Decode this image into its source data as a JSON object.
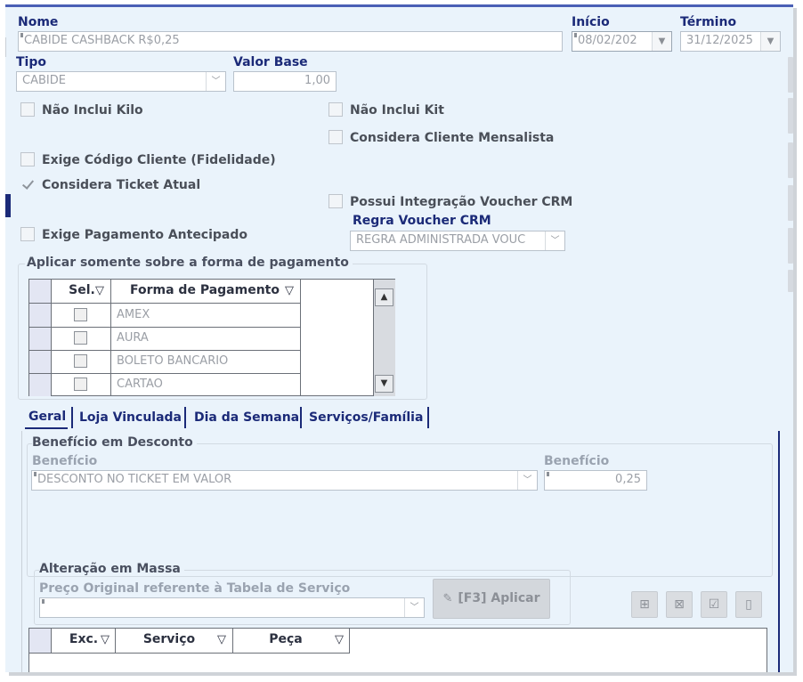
{
  "form": {
    "nome_label": "Nome",
    "nome_value": "CABIDE CASHBACK R$0,25",
    "inicio_label": "Início",
    "inicio_value": "08/02/202",
    "termino_label": "Término",
    "termino_value": "31/12/2025",
    "tipo_label": "Tipo",
    "tipo_value": "CABIDE",
    "valor_base_label": "Valor Base",
    "valor_base_value": "1,00",
    "regra_voucher_label": "Regra Voucher CRM",
    "regra_voucher_value": "REGRA ADMINISTRADA VOUC"
  },
  "checkboxes": {
    "nao_inclui_kilo": {
      "label": "Não Inclui Kilo",
      "checked": false
    },
    "nao_inclui_kit": {
      "label": "Não Inclui Kit",
      "checked": false
    },
    "considera_cliente_mensalista": {
      "label": "Considera Cliente Mensalista",
      "checked": false
    },
    "exige_codigo_cliente": {
      "label": "Exige Código Cliente (Fidelidade)",
      "checked": false
    },
    "considera_ticket_atual": {
      "label": "Considera Ticket Atual",
      "checked": true
    },
    "possui_integracao_voucher": {
      "label": "Possui Integração Voucher CRM",
      "checked": false
    },
    "exige_pagamento_antecipado": {
      "label": "Exige Pagamento Antecipado",
      "checked": false
    }
  },
  "payment_group": {
    "title": "Aplicar somente sobre a forma de pagamento",
    "col_sel": "Sel.",
    "col_forma": "Forma de Pagamento",
    "rows": [
      "AMEX",
      "AURA",
      "BOLETO BANCARIO",
      "CARTAO"
    ]
  },
  "tabs": [
    "Geral",
    "Loja Vinculada",
    "Dia da Semana",
    "Serviços/Família"
  ],
  "beneficio": {
    "group_title": "Benefício em Desconto",
    "beneficio_label": "Benefício",
    "beneficio_value": "DESCONTO NO TICKET EM VALOR",
    "beneficio_valor_label": "Benefício",
    "beneficio_valor_value": "0,25"
  },
  "alteracao": {
    "group_title": "Alteração em Massa",
    "preco_label": "Preço Original referente à Tabela de Serviço",
    "preco_value": "",
    "apply_button": "[F3] Aplicar"
  },
  "services_grid": {
    "col_exc": "Exc.",
    "col_servico": "Serviço",
    "col_peca": "Peça"
  },
  "icons": {
    "filter": "▽",
    "dropdown": "▼",
    "scroll_up": "▲",
    "scroll_down": "▼"
  }
}
